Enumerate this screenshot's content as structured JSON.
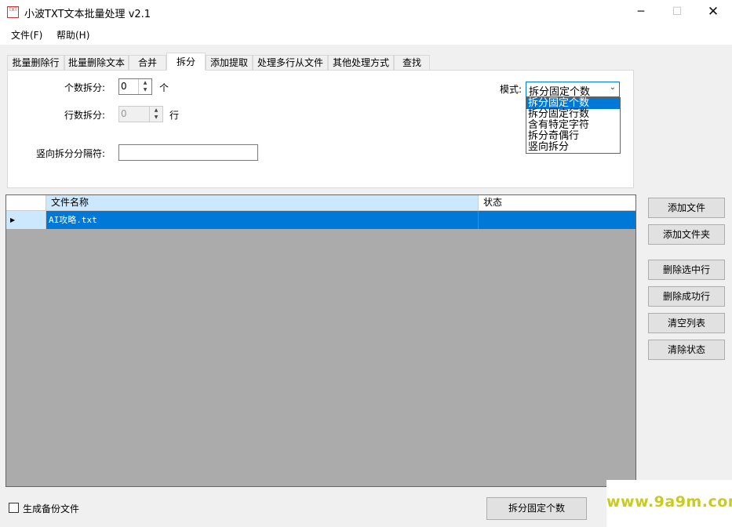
{
  "window": {
    "title": "小波TXT文本批量处理 v2.1",
    "icon_text": "TXT"
  },
  "menu": {
    "file": "文件(F)",
    "help": "帮助(H)"
  },
  "tabs": [
    "批量删除行",
    "批量删除文本",
    "合并",
    "拆分",
    "添加提取",
    "处理多行从文件",
    "其他处理方式",
    "查找"
  ],
  "active_tab": "拆分",
  "split": {
    "count_label": "个数拆分:",
    "count_value": "0",
    "count_unit": "个",
    "line_label": "行数拆分:",
    "line_value": "0",
    "line_unit": "行",
    "vertical_label": "竖向拆分分隔符:",
    "vertical_value": "",
    "mode_label": "模式:",
    "mode_value": "拆分固定个数",
    "mode_options": [
      "拆分固定个数",
      "拆分固定行数",
      "含有特定字符",
      "拆分奇偶行",
      "竖向拆分"
    ]
  },
  "grid": {
    "columns": [
      "文件名称",
      "状态"
    ],
    "rows": [
      {
        "name": "AI攻略.txt",
        "status": ""
      }
    ]
  },
  "side_buttons": {
    "add_file": "添加文件",
    "add_folder": "添加文件夹",
    "delete_selected": "删除选中行",
    "delete_success": "删除成功行",
    "clear_list": "清空列表",
    "clear_status": "清除状态"
  },
  "bottom": {
    "backup_label": "生成备份文件",
    "backup_checked": false,
    "run_label": "拆分固定个数"
  },
  "watermark": "www.9a9m.com"
}
